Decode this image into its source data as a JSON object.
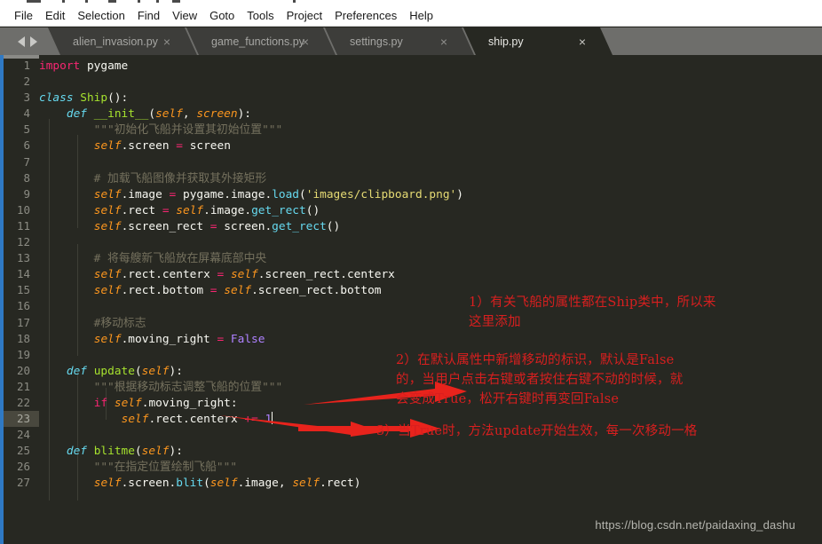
{
  "window": {
    "title_bar_visible_sliver": true
  },
  "menubar": {
    "items": [
      "File",
      "Edit",
      "Selection",
      "Find",
      "View",
      "Goto",
      "Tools",
      "Project",
      "Preferences",
      "Help"
    ]
  },
  "tabbar": {
    "nav_prev_icon": "triangle-left-icon",
    "nav_next_icon": "triangle-right-icon",
    "close_glyph": "×",
    "tabs": [
      {
        "label": "alien_invasion.py",
        "active": false
      },
      {
        "label": "game_functions.py",
        "active": false
      },
      {
        "label": "settings.py",
        "active": false
      },
      {
        "label": "ship.py",
        "active": true
      }
    ]
  },
  "editor": {
    "active_line": 23,
    "cursor_line": 23,
    "lines": [
      {
        "n": 1,
        "text": "import pygame"
      },
      {
        "n": 2,
        "text": ""
      },
      {
        "n": 3,
        "text": "class Ship():"
      },
      {
        "n": 4,
        "text": "    def __init__(self, screen):"
      },
      {
        "n": 5,
        "text": "        \"\"\"初始化飞船并设置其初始位置\"\"\""
      },
      {
        "n": 6,
        "text": "        self.screen = screen"
      },
      {
        "n": 7,
        "text": ""
      },
      {
        "n": 8,
        "text": "        # 加载飞船图像并获取其外接矩形"
      },
      {
        "n": 9,
        "text": "        self.image = pygame.image.load('images/clipboard.png')"
      },
      {
        "n": 10,
        "text": "        self.rect = self.image.get_rect()"
      },
      {
        "n": 11,
        "text": "        self.screen_rect = screen.get_rect()"
      },
      {
        "n": 12,
        "text": ""
      },
      {
        "n": 13,
        "text": "        # 将每艘新飞船放在屏幕底部中央"
      },
      {
        "n": 14,
        "text": "        self.rect.centerx = self.screen_rect.centerx"
      },
      {
        "n": 15,
        "text": "        self.rect.bottom = self.screen_rect.bottom"
      },
      {
        "n": 16,
        "text": ""
      },
      {
        "n": 17,
        "text": "        #移动标志"
      },
      {
        "n": 18,
        "text": "        self.moving_right = False"
      },
      {
        "n": 19,
        "text": ""
      },
      {
        "n": 20,
        "text": "    def update(self):"
      },
      {
        "n": 21,
        "text": "        \"\"\"根据移动标志调整飞船的位置\"\"\""
      },
      {
        "n": 22,
        "text": "        if self.moving_right:"
      },
      {
        "n": 23,
        "text": "            self.rect.centerx += 1"
      },
      {
        "n": 24,
        "text": ""
      },
      {
        "n": 25,
        "text": "    def blitme(self):"
      },
      {
        "n": 26,
        "text": "        \"\"\"在指定位置绘制飞船\"\"\""
      },
      {
        "n": 27,
        "text": "        self.screen.blit(self.image, self.rect)"
      }
    ]
  },
  "annotations": {
    "color": "#d81f1f",
    "notes": [
      {
        "id": "annot-1",
        "text": "1）有关飞船的属性都在Ship类中，所以来\n这里添加"
      },
      {
        "id": "annot-2",
        "text": "2）在默认属性中新增移动的标识，默认是False\n的，当用户点击右键或者按住右键不动的时候，就\n会变成True，松开右键时再变回False"
      },
      {
        "id": "annot-3",
        "text": "3）当True时，方法update开始生效，每一次移动一格"
      }
    ],
    "arrows": [
      {
        "id": "arrow-to-moving-right",
        "points_to": "line 18 self.moving_right = False"
      },
      {
        "id": "arrow-to-update-def",
        "points_to": "line 20 def update(self)"
      }
    ]
  },
  "watermark": {
    "text": "https://blog.csdn.net/paidaxing_dashu"
  }
}
